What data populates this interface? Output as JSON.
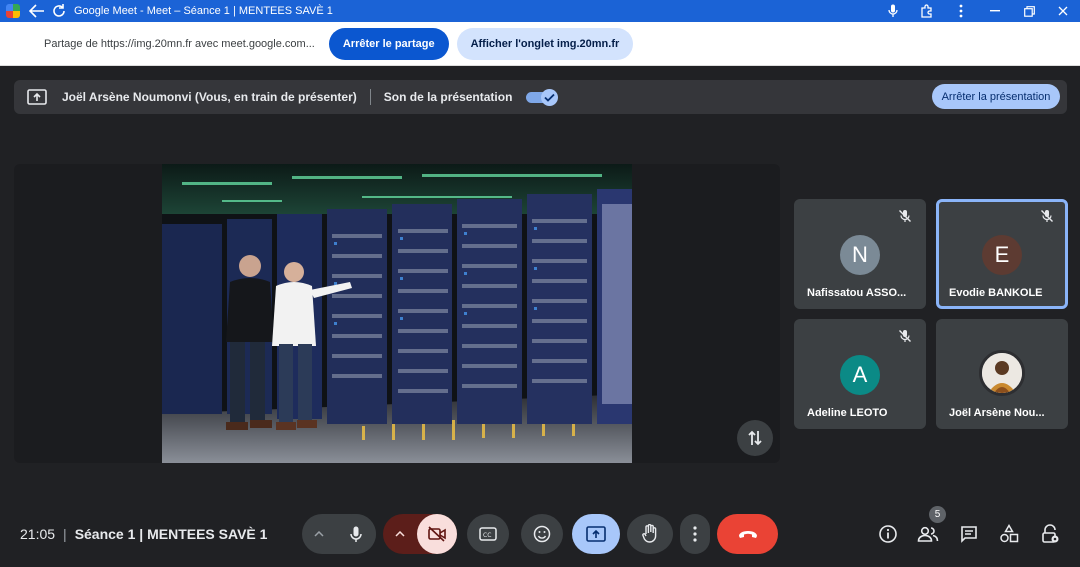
{
  "window": {
    "title": "Google Meet - Meet – Séance 1 | MENTEES SAVÈ 1"
  },
  "sharebar": {
    "message": "Partage de https://img.20mn.fr avec meet.google.com...",
    "stop_label": "Arrêter le partage",
    "show_tab_label": "Afficher l'onglet img.20mn.fr"
  },
  "presenting": {
    "presenter": "Joël Arsène Noumonvi (Vous, en train de présenter)",
    "audio_label": "Son de la présentation",
    "audio_on": true,
    "stop_label": "Arrêter la présentation"
  },
  "participants": [
    {
      "initial": "N",
      "name": "Nafissatou ASSO...",
      "avatar_color": "#7b8a96",
      "muted": true,
      "active": false
    },
    {
      "initial": "E",
      "name": "Evodie BANKOLE",
      "avatar_color": "#5d3b32",
      "muted": true,
      "active": true
    },
    {
      "initial": "A",
      "name": "Adeline LEOTO",
      "avatar_color": "#0b8a86",
      "muted": true,
      "active": false
    },
    {
      "initial": "",
      "name": "Joël Arsène Nou...",
      "avatar_color": "#6b4a2e",
      "muted": false,
      "active": false
    }
  ],
  "meeting": {
    "time": "21:05",
    "name": "Séance 1 | MENTEES SAVÈ 1",
    "participant_count": "5"
  },
  "colors": {
    "accent": "#0b57d0",
    "hangup": "#ea4335",
    "camera_off_bg": "#f9dedc",
    "camera_chevron_bg": "#5c1e1a",
    "present_active_bg": "#a8c7fa"
  }
}
